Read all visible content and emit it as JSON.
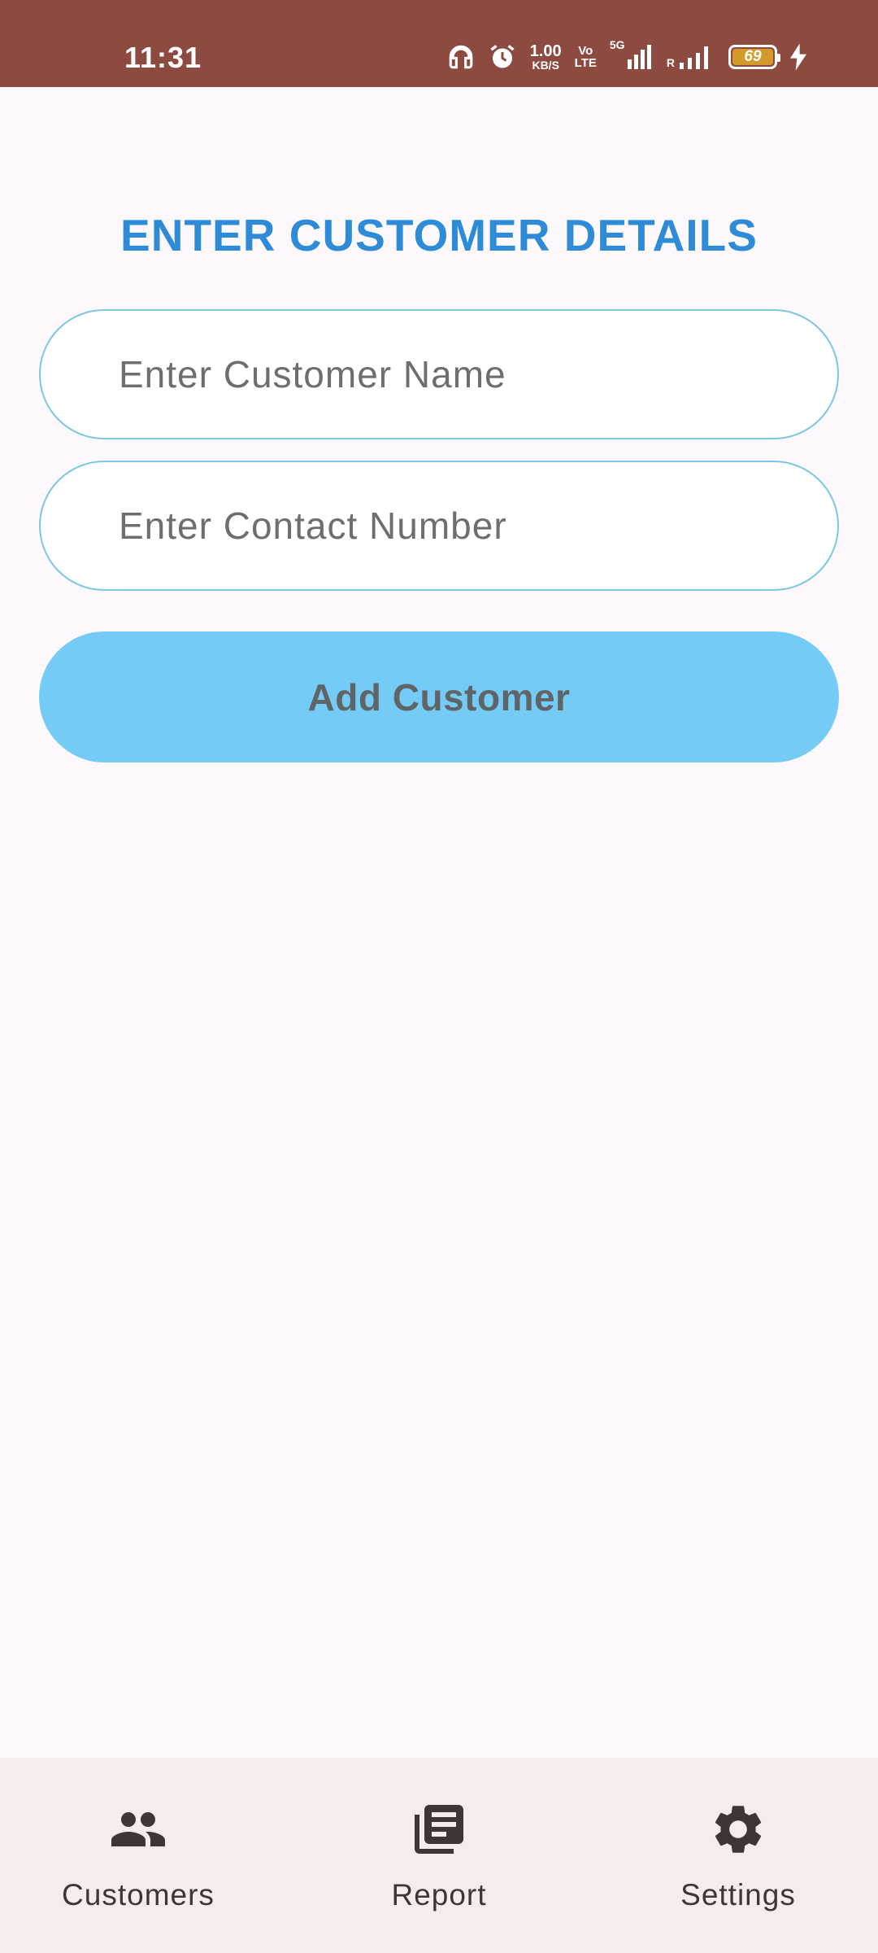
{
  "status_bar": {
    "time": "11:31",
    "net_speed_value": "1.00",
    "net_speed_unit": "KB/S",
    "volte_top": "Vo",
    "volte_bottom": "LTE",
    "network_5g": "5G",
    "roaming": "R",
    "battery_level": "69",
    "icons": [
      "headphones-icon",
      "alarm-icon",
      "signal-5g-icon",
      "signal-icon",
      "battery-icon",
      "charging-icon"
    ]
  },
  "main": {
    "title": "ENTER CUSTOMER DETAILS",
    "name_field": {
      "placeholder": "Enter Customer Name",
      "value": ""
    },
    "contact_field": {
      "placeholder": "Enter Contact Number",
      "value": ""
    },
    "add_button_label": "Add Customer"
  },
  "bottom_nav": {
    "items": [
      {
        "label": "Customers",
        "icon": "people-icon"
      },
      {
        "label": "Report",
        "icon": "report-icon"
      },
      {
        "label": "Settings",
        "icon": "gear-icon"
      }
    ]
  },
  "colors": {
    "status_bar": "#8C4A40",
    "background": "#FDF8FC",
    "title": "#2D8BD8",
    "field_border": "#7CC7E3",
    "button": "#74CBF5",
    "button_text": "#5F6566",
    "nav_background": "#F5ECEC",
    "nav_text": "#3E3535"
  }
}
